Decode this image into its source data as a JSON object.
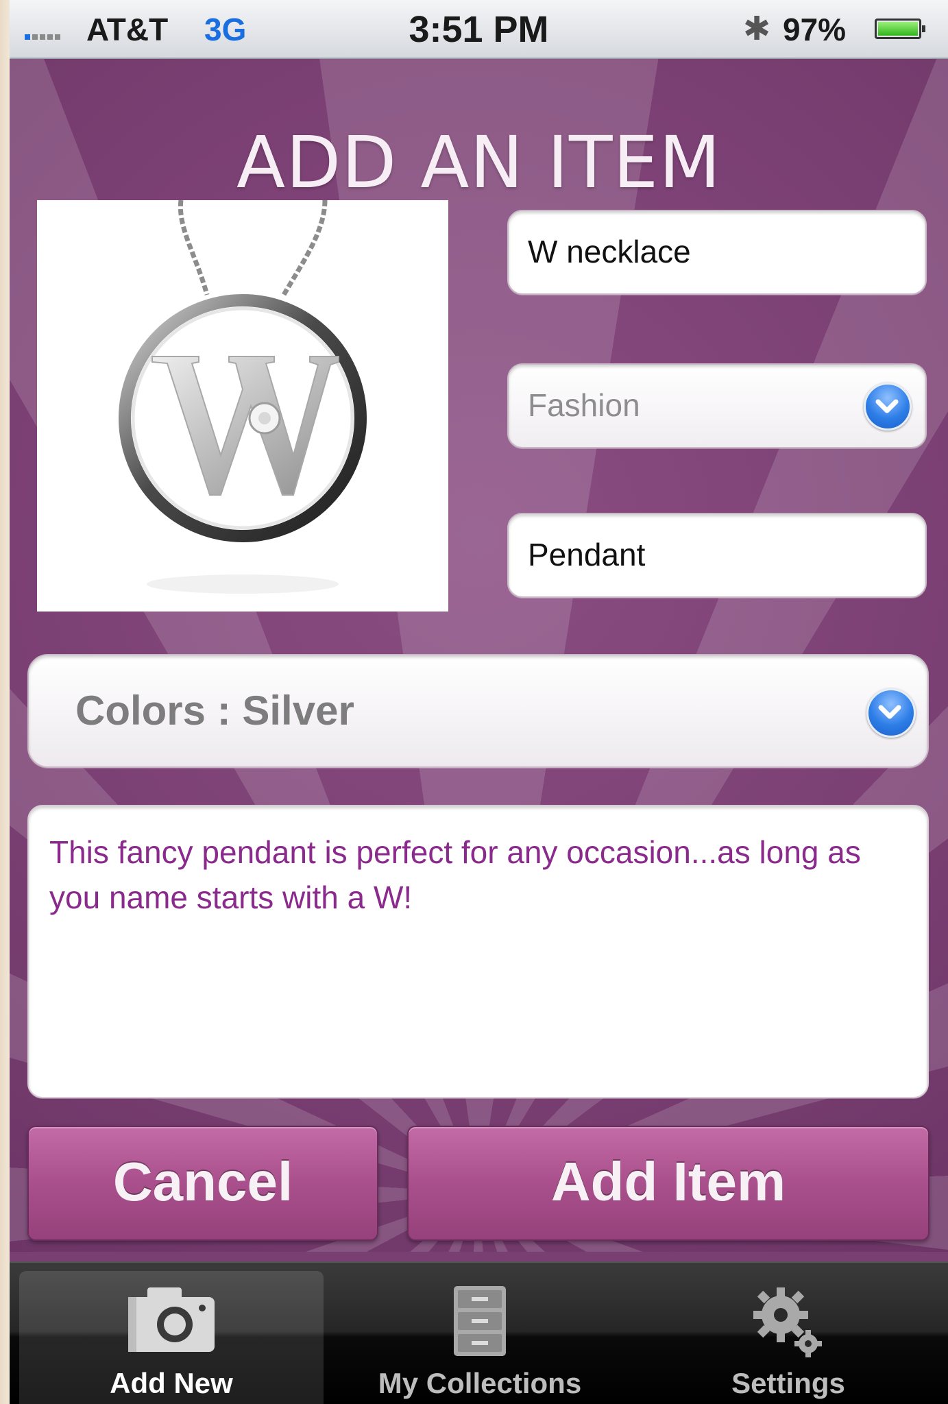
{
  "status_bar": {
    "carrier": "AT&T",
    "network": "3G",
    "time": "3:51 PM",
    "battery_percent": "97%"
  },
  "screen": {
    "title": "ADD AN ITEM"
  },
  "form": {
    "name_value": "W necklace",
    "category_value": "Fashion",
    "type_value": "Pendant",
    "colors_value": "Colors : Silver",
    "description_value": "This fancy pendant is perfect for any occasion...as long as you name starts with a W!"
  },
  "buttons": {
    "cancel_label": "Cancel",
    "add_label": "Add Item"
  },
  "tabbar": {
    "tabs": [
      {
        "label": "Add New",
        "icon": "camera-icon",
        "active": true
      },
      {
        "label": "My Collections",
        "icon": "file-cabinet-icon",
        "active": false
      },
      {
        "label": "Settings",
        "icon": "gears-icon",
        "active": false
      }
    ]
  },
  "colors": {
    "background": "#7a3f72",
    "button": "#a9508c",
    "description_text": "#8a2a8c",
    "chevron": "#2e7ee8"
  }
}
